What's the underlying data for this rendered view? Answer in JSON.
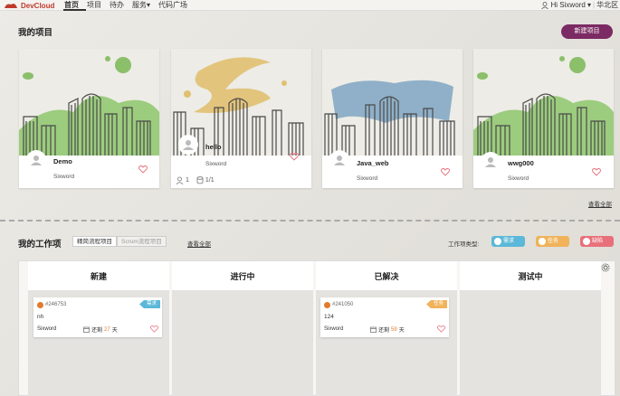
{
  "brand": {
    "name": "DevCloud"
  },
  "nav": [
    {
      "label": "首页",
      "active": true
    },
    {
      "label": "项目"
    },
    {
      "label": "待办"
    },
    {
      "label": "服务▾"
    },
    {
      "label": "代码广场"
    }
  ],
  "user": {
    "greeting": "Hi Sixword ▾",
    "divider": "|",
    "region": "华北区"
  },
  "projects_section": {
    "title": "我的项目",
    "new_button": "新建项目",
    "see_all": "查看全部"
  },
  "projects": [
    {
      "name": "Demo",
      "owner": "Sixword",
      "style": "green"
    },
    {
      "name": "hello",
      "owner": "Sixword",
      "style": "yellow",
      "members": "1",
      "repos": "1/1"
    },
    {
      "name": "Java_web",
      "owner": "Sixword",
      "style": "blue"
    },
    {
      "name": "wwg000",
      "owner": "Sixword",
      "style": "green"
    }
  ],
  "work_section": {
    "title": "我的工作项",
    "tabs": [
      "精简流程项目",
      "Scrum流程项目"
    ],
    "see_all": "查看全部",
    "types_label": "工作项类型:"
  },
  "work_types": [
    {
      "label": "需求",
      "color": "#5bb8d8"
    },
    {
      "label": "任务",
      "color": "#f0b35a"
    },
    {
      "label": "缺陷",
      "color": "#e8707a"
    }
  ],
  "columns": [
    {
      "label": "新建"
    },
    {
      "label": "进行中"
    },
    {
      "label": "已解决"
    },
    {
      "label": "测试中"
    }
  ],
  "work_items": [
    {
      "column": "新建",
      "id": "#246753",
      "type": "需求",
      "type_color": "#5bb8d8",
      "title": "nh",
      "owner": "Sixword",
      "due_prefix": "还剩",
      "due_days": "27",
      "due_unit": "天"
    },
    {
      "column": "已解决",
      "id": "#241050",
      "type": "任务",
      "type_color": "#f0b35a",
      "title": "124",
      "owner": "Sixword",
      "due_prefix": "还剩",
      "due_days": "59",
      "due_unit": "天"
    }
  ],
  "colors": {
    "accent": "#7b2a63",
    "brand": "#c0392b"
  }
}
